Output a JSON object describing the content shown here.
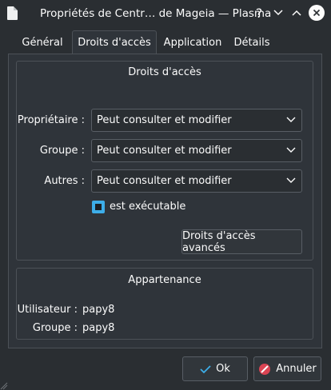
{
  "window": {
    "title": "Propriétés de Centr… de Mageia — Plasma",
    "help_icon": "question-icon",
    "minimize_icon": "chevron-down-icon",
    "maximize_icon": "chevron-up-icon",
    "close_icon": "close-icon"
  },
  "tabs": [
    {
      "label": "Général",
      "active": false
    },
    {
      "label": "Droits d'accès",
      "active": true
    },
    {
      "label": "Application",
      "active": false
    },
    {
      "label": "Détails",
      "active": false
    }
  ],
  "permissions": {
    "title": "Droits d'accès",
    "owner_label": "Propriétaire :",
    "owner_value": "Peut consulter et modifier",
    "group_label": "Groupe :",
    "group_value": "Peut consulter et modifier",
    "others_label": "Autres :",
    "others_value": "Peut consulter et modifier",
    "executable_label": "est exécutable",
    "executable_checked": true,
    "advanced_button": "Droits d'accès avancés"
  },
  "ownership": {
    "title": "Appartenance",
    "user_label": "Utilisateur :",
    "user_value": "papy8",
    "group_label": "Groupe :",
    "group_value": "papy8"
  },
  "buttons": {
    "ok": "Ok",
    "cancel": "Annuler"
  },
  "colors": {
    "accent": "#3daee9",
    "background": "#2a2e32",
    "text": "#fcfcfc"
  }
}
